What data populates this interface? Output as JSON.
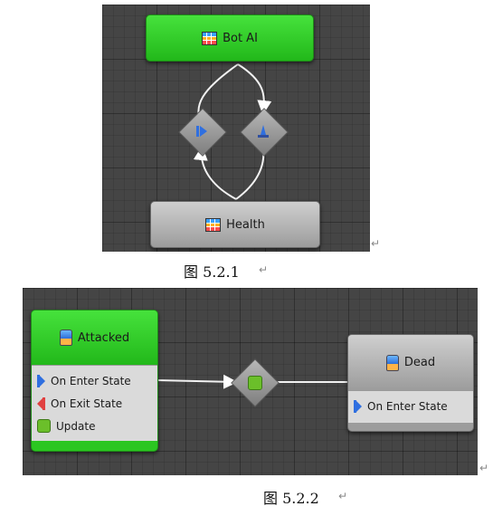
{
  "figure1": {
    "top_node": "Bot AI",
    "bottom_node": "Health",
    "caption": "图 5.2.1"
  },
  "figure2": {
    "left_node": {
      "title": "Attacked",
      "items": [
        "On Enter State",
        "On Exit State",
        "Update"
      ]
    },
    "right_node": {
      "title": "Dead",
      "items": [
        "On Enter State"
      ]
    },
    "caption": "图 5.2.2"
  },
  "return_mark": "↵",
  "icons": [
    "grid-icon",
    "skip-forward-icon",
    "fountain-icon",
    "state-icon",
    "enter-icon",
    "exit-icon",
    "update-icon"
  ],
  "colors": {
    "green": "#2bc621",
    "canvas": "#454545",
    "node_gray": "#b5b5b5"
  }
}
